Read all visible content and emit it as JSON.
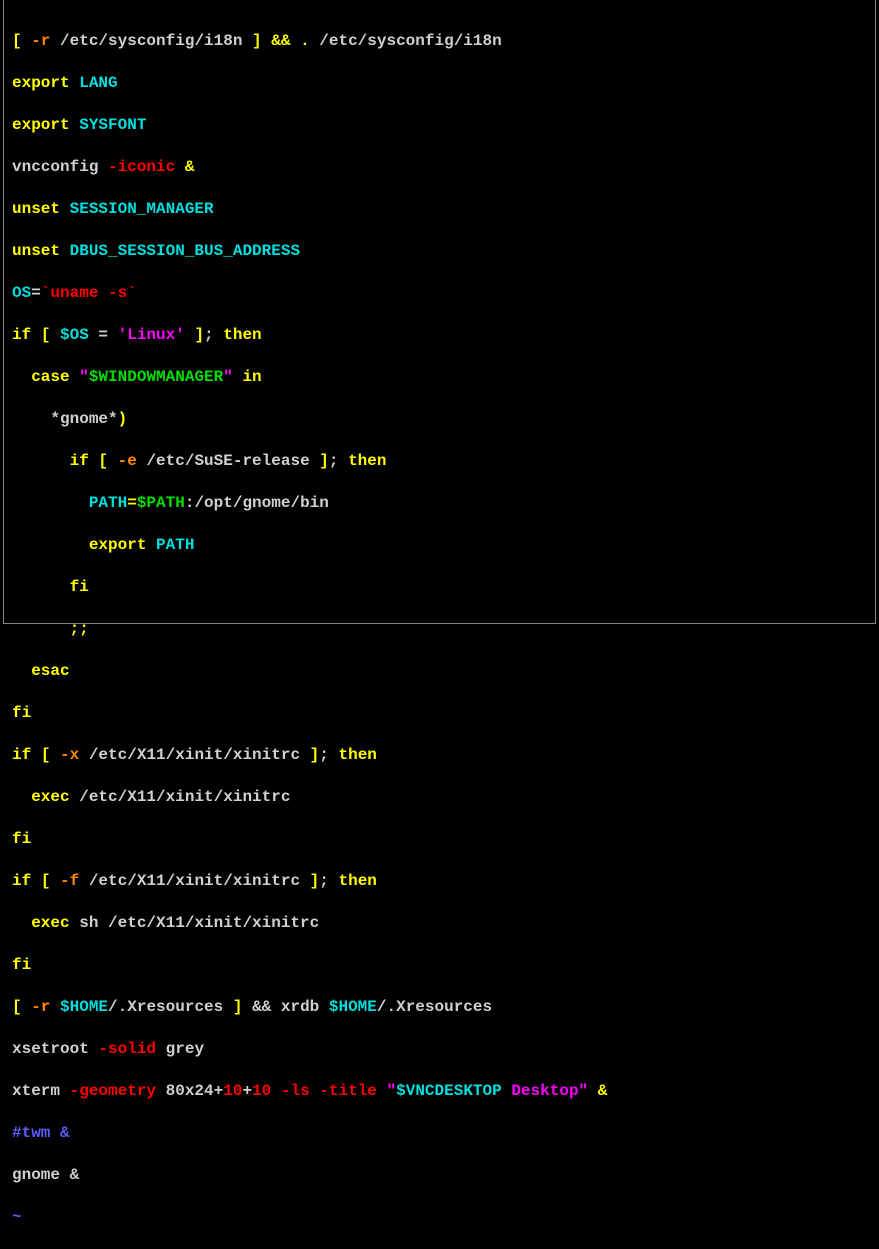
{
  "code": {
    "l0": {
      "a": "[ ",
      "b": "-r ",
      "c": "/etc/sysconfig/i18n ",
      "d": "] ",
      "e": "&& ",
      "f": ". ",
      "g": "/etc/sysconfig/i18n"
    },
    "l1": {
      "a": "export ",
      "b": "LANG"
    },
    "l2": {
      "a": "export ",
      "b": "SYSFONT"
    },
    "l3": {
      "a": "vncconfig ",
      "b": "-iconic ",
      "c": "&"
    },
    "l4": {
      "a": "unset ",
      "b": "SESSION_MANAGER"
    },
    "l5": {
      "a": "unset ",
      "b": "DBUS_SESSION_BUS_ADDRESS"
    },
    "l6": {
      "a": "OS",
      "b": "=",
      "c": "`",
      "d": "uname -s",
      "e": "`"
    },
    "l7": {
      "a": "if ",
      "b": "[ ",
      "c": "$OS ",
      "d": "= ",
      "e": "'Linux' ",
      "f": "]",
      "g": "; ",
      "h": "then"
    },
    "l8": {
      "a": "  case ",
      "b": "\"",
      "c": "$WINDOWMANAGER",
      "d": "\" ",
      "e": "in"
    },
    "l9": {
      "a": "    *gnome*",
      "b": ")"
    },
    "l10": {
      "a": "      if ",
      "b": "[ ",
      "c": "-e ",
      "d": "/etc/SuSE-release ",
      "e": "]",
      "f": "; ",
      "g": "then"
    },
    "l11": {
      "a": "        ",
      "b": "PATH",
      "c": "=",
      "d": "$PATH",
      "e": ":/opt/gnome/bin"
    },
    "l12": {
      "a": "        export ",
      "b": "PATH"
    },
    "l13": {
      "a": "      fi"
    },
    "l14": {
      "a": "      ;;"
    },
    "l15": {
      "a": "  esac"
    },
    "l16": {
      "a": "fi"
    },
    "l17": {
      "a": "if ",
      "b": "[ ",
      "c": "-x ",
      "d": "/etc/X11/xinit/xinitrc ",
      "e": "]",
      "f": "; ",
      "g": "then"
    },
    "l18": {
      "a": "  exec ",
      "b": "/etc/X11/xinit/xinitrc"
    },
    "l19": {
      "a": "fi"
    },
    "l20": {
      "a": "if ",
      "b": "[ ",
      "c": "-f ",
      "d": "/etc/X11/xinit/xinitrc ",
      "e": "]",
      "f": "; ",
      "g": "then"
    },
    "l21": {
      "a": "  exec ",
      "b": "sh /etc/X11/xinit/xinitrc"
    },
    "l22": {
      "a": "fi"
    },
    "l23": {
      "a": "[ ",
      "b": "-r ",
      "c": "$HOME",
      "d": "/.Xresources ",
      "e": "] ",
      "f": "&& xrdb ",
      "g": "$HOME",
      "h": "/.Xresources"
    },
    "l24": {
      "a": "xsetroot ",
      "b": "-solid ",
      "c": "grey"
    },
    "l25": {
      "a": "xterm ",
      "b": "-geometry ",
      "c": "80x24",
      "d": "+",
      "e": "10",
      "f": "+",
      "g": "10 ",
      "h": "-ls -title ",
      "i": "\"",
      "j": "$VNCDESKTOP ",
      "k": "Desktop",
      "l": "\" ",
      "m": "&"
    },
    "l26": {
      "a": "#twm &"
    },
    "l27": {
      "a": "gnome &"
    },
    "l28": {
      "a": "~"
    }
  }
}
